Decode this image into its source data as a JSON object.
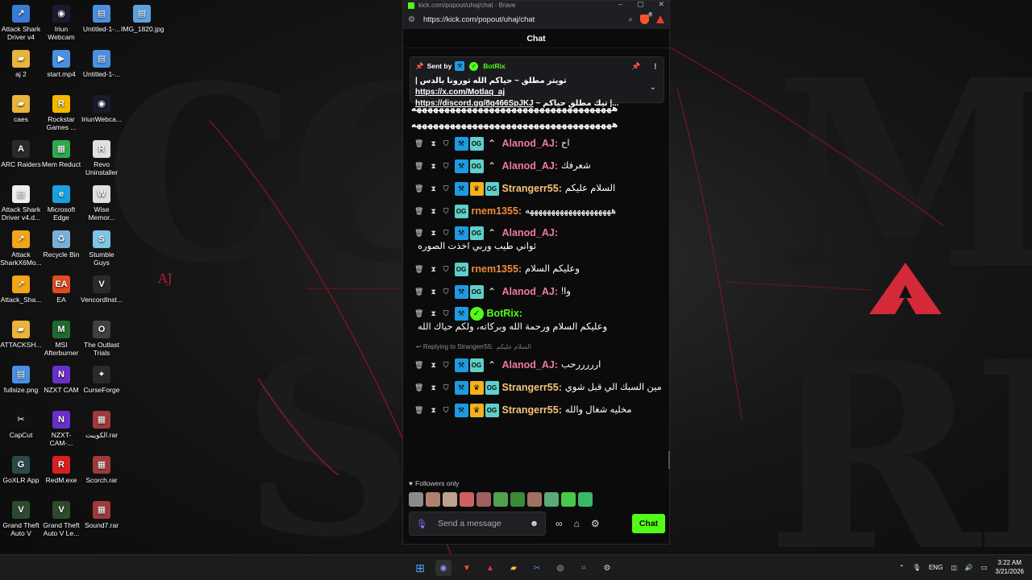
{
  "desktop": {
    "icons": [
      {
        "label": "Attack Shark Driver v4",
        "color": "#3a7bd5",
        "glyph": "↗"
      },
      {
        "label": "Iriun Webcam",
        "color": "#1a1a2e",
        "glyph": "◉"
      },
      {
        "label": "Untitled-1-...",
        "color": "#4a90e2",
        "glyph": "▤"
      },
      {
        "label": "IMG_1820.jpg",
        "color": "#5ba3e0",
        "glyph": "▤"
      },
      {
        "label": "aj 2",
        "color": "#e8b43a",
        "glyph": "▰"
      },
      {
        "label": "start.mp4",
        "color": "#4a90e2",
        "glyph": "▶"
      },
      {
        "label": "Untitled-1-...",
        "color": "#4a90e2",
        "glyph": "▤"
      },
      {
        "label": "caes",
        "color": "#e8b43a",
        "glyph": "▰"
      },
      {
        "label": "Rockstar Games ...",
        "color": "#f5b800",
        "glyph": "R"
      },
      {
        "label": "IriunWebca...",
        "color": "#1a1a2e",
        "glyph": "◉"
      },
      {
        "label": "ARC Raiders",
        "color": "#2a2a2a",
        "glyph": "A"
      },
      {
        "label": "Mem Reduct",
        "color": "#2eaa4a",
        "glyph": "▦"
      },
      {
        "label": "Revo Uninstaller",
        "color": "#e0e0e0",
        "glyph": "R"
      },
      {
        "label": "Attack Shark Driver v4.d...",
        "color": "#eeeeee",
        "glyph": "▤"
      },
      {
        "label": "Microsoft Edge",
        "color": "#1aa0e0",
        "glyph": "e"
      },
      {
        "label": "Wise Memor...",
        "color": "#e0e0e0",
        "glyph": "W"
      },
      {
        "label": "Attack SharkX6Mo...",
        "color": "#f2a516",
        "glyph": "↗"
      },
      {
        "label": "Recycle Bin",
        "color": "#7ab0d8",
        "glyph": "♻"
      },
      {
        "label": "Stumble Guys",
        "color": "#7fc4e8",
        "glyph": "S"
      },
      {
        "label": "Attack_Sha...",
        "color": "#f2a516",
        "glyph": "↗"
      },
      {
        "label": "EA",
        "color": "#e24a1f",
        "glyph": "EA"
      },
      {
        "label": "VencordInst...",
        "color": "#2a2a2a",
        "glyph": "V"
      },
      {
        "label": "ATTACKSH...",
        "color": "#e8b43a",
        "glyph": "▰"
      },
      {
        "label": "MSI Afterburner",
        "color": "#1e6b2e",
        "glyph": "M"
      },
      {
        "label": "The Outlast Trials",
        "color": "#404040",
        "glyph": "O"
      },
      {
        "label": "fullsize.png",
        "color": "#4a90e2",
        "glyph": "▤"
      },
      {
        "label": "NZXT CAM",
        "color": "#6a2fc8",
        "glyph": "N"
      },
      {
        "label": "CurseForge",
        "color": "#2a2a2a",
        "glyph": "✦"
      },
      {
        "label": "CapCut",
        "color": "#111111",
        "glyph": "✂"
      },
      {
        "label": "NZXT-CAM-...",
        "color": "#6a2fc8",
        "glyph": "N"
      },
      {
        "label": "الكويبت.rar",
        "color": "#a03a3a",
        "glyph": "▦"
      },
      {
        "label": "GoXLR App",
        "color": "#2a4a4a",
        "glyph": "G"
      },
      {
        "label": "RedM.exe",
        "color": "#d82020",
        "glyph": "R"
      },
      {
        "label": "Scorch.rar",
        "color": "#a03a3a",
        "glyph": "▦"
      },
      {
        "label": "Grand Theft Auto V",
        "color": "#2e4a2e",
        "glyph": "V"
      },
      {
        "label": "Grand Theft Auto V Le...",
        "color": "#2e4a2e",
        "glyph": "V"
      },
      {
        "label": "Sound7.rar",
        "color": "#a03a3a",
        "glyph": "▦"
      }
    ],
    "aj_logo": "AJ"
  },
  "browser": {
    "title": "kick.com/popout/uhaj/chat - Brave",
    "url": "https://kick.com/popout/uhaj/chat",
    "shield_count": "9"
  },
  "chat": {
    "header": "Chat",
    "pinned": {
      "sent_by_label": "Sent by",
      "user": "BotRix",
      "line1_text": "تويتر مطلق ~ حياكم الله تورونا بالدس |",
      "line1_link": "https://x.com/Motlaq_aj",
      "line2_text": "...| تيك مطلق حياكم ~",
      "line2_link": "https://discord.gg/8q466SpJKJ"
    },
    "top_long_text": "ههههههههههههههههههههههههههههههههههههه",
    "top_long_text2": "ههههههههههههههههههههههههههههههههههههه",
    "messages": [
      {
        "user": "Alanod_AJ",
        "color": "#f27a9a",
        "badges": [
          "blue",
          "og",
          "gray"
        ],
        "text": "اح"
      },
      {
        "user": "Alanod_AJ",
        "color": "#f27a9a",
        "badges": [
          "blue",
          "og",
          "gray"
        ],
        "text": "شعرفك"
      },
      {
        "user": "Strangerr55",
        "color": "#f6c37a",
        "badges": [
          "blue",
          "gold",
          "og"
        ],
        "text": "السلام عليكم"
      },
      {
        "user": "rnem1355",
        "color": "#f08a3a",
        "badges": [
          "og"
        ],
        "text": "ههههههههههههههههههههه"
      },
      {
        "user": "Alanod_AJ",
        "color": "#f27a9a",
        "badges": [
          "blue",
          "og",
          "gray"
        ],
        "text": "ثواني طيب وربي اخذت الصوره"
      },
      {
        "user": "rnem1355",
        "color": "#f08a3a",
        "badges": [
          "og"
        ],
        "text": "وعليكم السلام"
      },
      {
        "user": "Alanod_AJ",
        "color": "#f27a9a",
        "badges": [
          "blue",
          "og",
          "gray"
        ],
        "text": "وا!"
      },
      {
        "user": "BotRix",
        "color": "#53fc18",
        "badges": [
          "blue",
          "green"
        ],
        "text": "وعليكم السلام ورحمة الله وبركاته، ولكم حياك الله"
      },
      {
        "user": "Alanod_AJ",
        "color": "#f27a9a",
        "badges": [
          "blue",
          "og",
          "gray"
        ],
        "text": "ارررررحب",
        "reply_to": "Replying to Strangerr55:",
        "reply_text": "السلام عليكم"
      },
      {
        "user": "Strangerr55",
        "color": "#f6c37a",
        "badges": [
          "blue",
          "gold",
          "og"
        ],
        "text": "مين السبك الي قبل شوي"
      },
      {
        "user": "Strangerr55",
        "color": "#f6c37a",
        "badges": [
          "blue",
          "gold",
          "og"
        ],
        "text": "مخليه شغال والله"
      }
    ],
    "followers_only": "Followers only",
    "avatar_colors": [
      "#8a8a8a",
      "#b08070",
      "#c0a090",
      "#d06060",
      "#a06060",
      "#50a050",
      "#3a8a3a",
      "#a07060",
      "#5aaa7a",
      "#4ac84a",
      "#3ab86a"
    ],
    "input_placeholder": "Send a message",
    "send_label": "Chat"
  },
  "taskbar": {
    "lang": "ENG",
    "time": "3:22 AM",
    "date": "3/21/2026"
  }
}
